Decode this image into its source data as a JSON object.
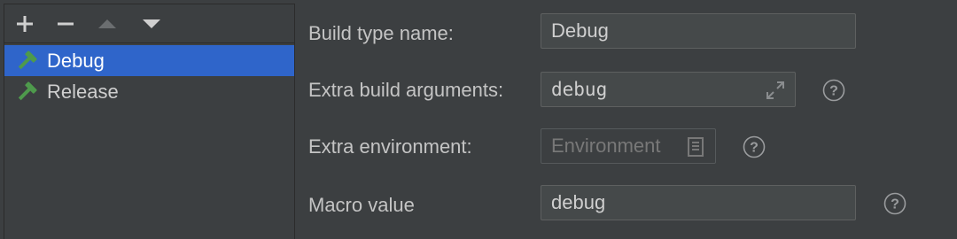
{
  "toolbar": {
    "add_icon": "plus-icon",
    "remove_icon": "minus-icon",
    "move_up_icon": "triangle-up-icon",
    "move_down_icon": "triangle-down-icon"
  },
  "build_types": [
    {
      "label": "Debug",
      "icon": "hammer-icon",
      "selected": true
    },
    {
      "label": "Release",
      "icon": "hammer-icon",
      "selected": false
    }
  ],
  "form": {
    "build_type_name": {
      "label": "Build type name:",
      "value": "Debug"
    },
    "extra_build_arguments": {
      "label": "Extra build arguments:",
      "value": "debug",
      "icon": "expand-icon"
    },
    "extra_environment": {
      "label": "Extra environment:",
      "placeholder": "Environment",
      "icon": "document-icon"
    },
    "macro_value": {
      "label": "Macro value",
      "value": "debug"
    }
  },
  "help_icon": "question-circle-icon",
  "colors": {
    "background": "#3c3f41",
    "selection": "#2f65ca",
    "hammer_green": "#4e9a4c",
    "field_bg": "#45494a"
  }
}
